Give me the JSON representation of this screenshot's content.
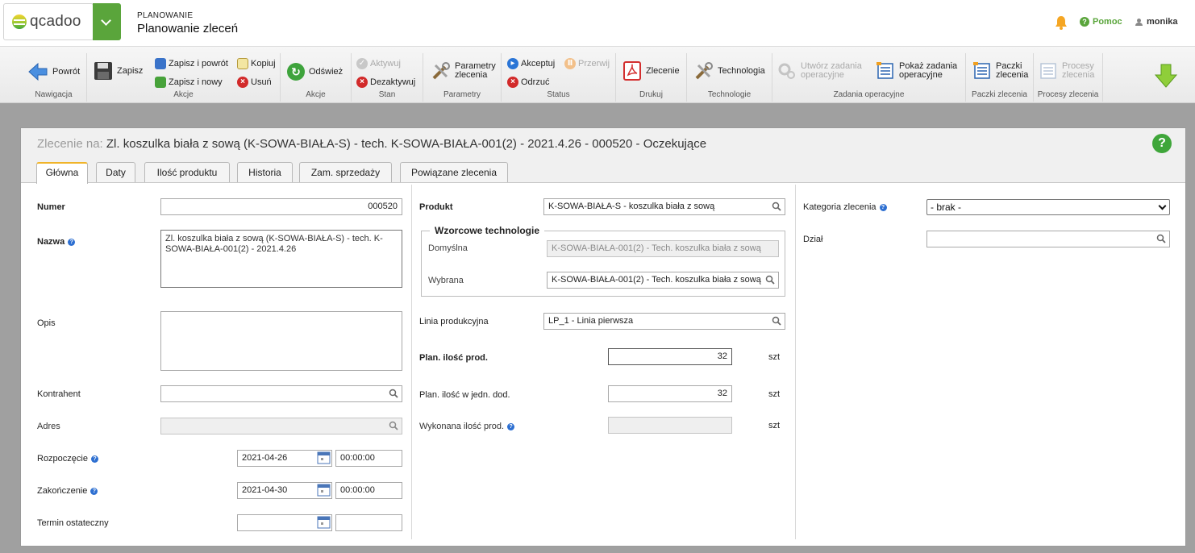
{
  "header": {
    "logo_text": "qcadoo",
    "module_label": "PLANOWANIE",
    "page_title": "Planowanie zleceń",
    "help_label": "Pomoc",
    "user_name": "monika"
  },
  "ribbon": {
    "groups": {
      "nawigacja": "Nawigacja",
      "akcje1": "Akcje",
      "akcje2": "Akcje",
      "stan": "Stan",
      "parametry": "Parametry",
      "status": "Status",
      "drukuj": "Drukuj",
      "technologie": "Technologie",
      "zadania": "Zadania operacyjne",
      "paczki": "Paczki zlecenia",
      "procesy": "Procesy zlecenia"
    },
    "buttons": {
      "powrot": "Powrót",
      "zapisz": "Zapisz",
      "zapisz_powrot": "Zapisz i powrót",
      "zapisz_nowy": "Zapisz i nowy",
      "kopiuj": "Kopiuj",
      "usun": "Usuń",
      "odswiez": "Odśwież",
      "aktywuj": "Aktywuj",
      "dezaktywuj": "Dezaktywuj",
      "parametry_l1": "Parametry",
      "parametry_l2": "zlecenia",
      "akceptuj": "Akceptuj",
      "przerwij": "Przerwij",
      "odrzuc": "Odrzuć",
      "zlecenie": "Zlecenie",
      "technologia": "Technologia",
      "utworz_l1": "Utwórz zadania",
      "utworz_l2": "operacyjne",
      "pokaz_l1": "Pokaż zadania",
      "pokaz_l2": "operacyjne",
      "paczki_l1": "Paczki",
      "paczki_l2": "zlecenia",
      "procesy_l1": "Procesy",
      "procesy_l2": "zlecenia"
    }
  },
  "record": {
    "title_prefix": "Zlecenie na:",
    "title": "Zl. koszulka biała z sową (K-SOWA-BIAŁA-S) - tech. K-SOWA-BIAŁA-001(2) - 2021.4.26 - 000520 - Oczekujące"
  },
  "tabs": [
    "Główna",
    "Daty",
    "Ilość produktu",
    "Historia",
    "Zam. sprzedaży",
    "Powiązane zlecenia"
  ],
  "form": {
    "numer_label": "Numer",
    "numer_value": "000520",
    "nazwa_label": "Nazwa",
    "nazwa_value": "Zl. koszulka biała z sową (K-SOWA-BIAŁA-S) - tech. K-SOWA-BIAŁA-001(2) - 2021.4.26",
    "opis_label": "Opis",
    "opis_value": "",
    "kontrahent_label": "Kontrahent",
    "kontrahent_value": "",
    "adres_label": "Adres",
    "adres_value": "",
    "rozpoczecie_label": "Rozpoczęcie",
    "rozpoczecie_date": "2021-04-26",
    "rozpoczecie_time": "00:00:00",
    "zakonczenie_label": "Zakończenie",
    "zakonczenie_date": "2021-04-30",
    "zakonczenie_time": "00:00:00",
    "termin_label": "Termin ostateczny",
    "termin_date": "",
    "termin_time": "",
    "produkt_label": "Produkt",
    "produkt_value": "K-SOWA-BIAŁA-S - koszulka biała z sową",
    "wzorcowe_legend": "Wzorcowe technologie",
    "domyslna_label": "Domyślna",
    "domyslna_value": "K-SOWA-BIAŁA-001(2) - Tech. koszulka biała z sową",
    "wybrana_label": "Wybrana",
    "wybrana_value": "K-SOWA-BIAŁA-001(2) - Tech. koszulka biała z sową",
    "linia_label": "Linia produkcyjna",
    "linia_value": "LP_1 - Linia pierwsza",
    "plan_ilosc_label": "Plan. ilość prod.",
    "plan_ilosc_value": "32",
    "plan_ilosc_dod_label": "Plan. ilość w jedn. dod.",
    "plan_ilosc_dod_value": "32",
    "wykonana_label": "Wykonana ilość prod.",
    "wykonana_value": "",
    "unit": "szt",
    "kategoria_label": "Kategoria zlecenia",
    "kategoria_value": "- brak -",
    "dzial_label": "Dział",
    "dzial_value": ""
  }
}
